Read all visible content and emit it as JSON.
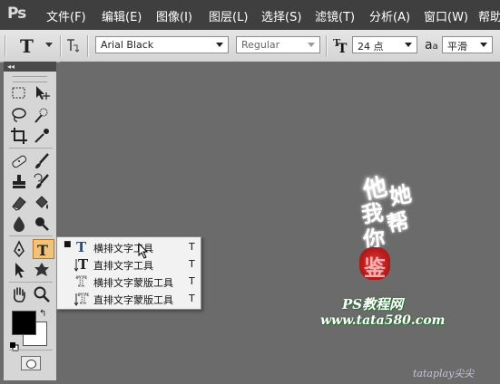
{
  "app": {
    "logo": "Ps"
  },
  "menu": [
    {
      "label": "文件(F)"
    },
    {
      "label": "编辑(E)"
    },
    {
      "label": "图像(I)"
    },
    {
      "label": "图层(L)"
    },
    {
      "label": "选择(S)"
    },
    {
      "label": "滤镜(T)"
    },
    {
      "label": "分析(A)"
    },
    {
      "label": "窗口(W)"
    },
    {
      "label": "帮助"
    }
  ],
  "options": {
    "font_family": "Arial Black",
    "font_style": "Regular",
    "font_size": "24 点",
    "aa_label": "a",
    "antialias": "平滑"
  },
  "flyout": {
    "items": [
      {
        "label": "横排文字工具",
        "shortcut": "T",
        "selected": true
      },
      {
        "label": "直排文字工具",
        "shortcut": "T",
        "selected": false
      },
      {
        "label": "横排文字蒙版工具",
        "shortcut": "T",
        "selected": false
      },
      {
        "label": "直排文字蒙版工具",
        "shortcut": "T",
        "selected": false
      }
    ]
  },
  "colors": {
    "foreground": "#000000",
    "background": "#ffffff",
    "active_tool": "#f0c27a"
  },
  "watermark": {
    "calligraphy": [
      "他",
      "她",
      "我",
      "帮",
      "你",
      "鉴"
    ],
    "line1": "PS教程网",
    "line2": "www.tata580.com",
    "corner": "tataplay尖尖"
  }
}
